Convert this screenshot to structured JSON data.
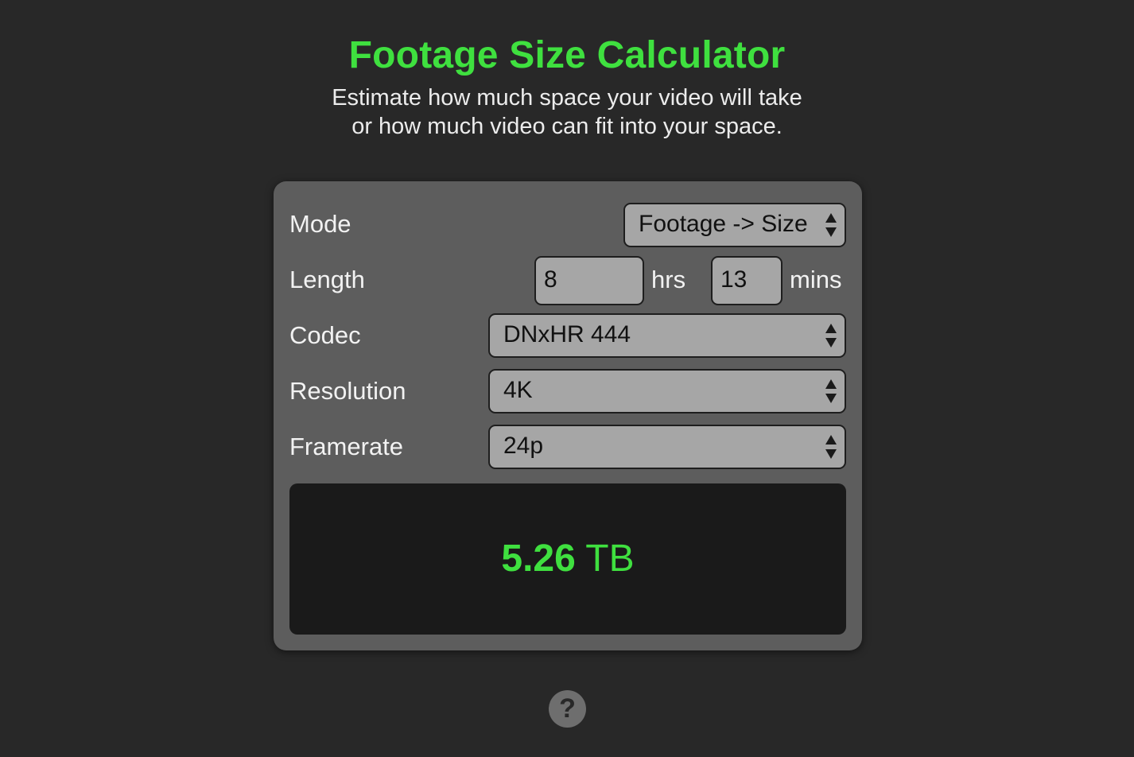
{
  "header": {
    "title": "Footage Size Calculator",
    "subtitle_line1": "Estimate how much space your video will take",
    "subtitle_line2": "or how much video can fit into your space."
  },
  "form": {
    "mode_label": "Mode",
    "mode_value": "Footage -> Size",
    "length_label": "Length",
    "hours_value": "8",
    "hours_unit": "hrs",
    "minutes_value": "13",
    "minutes_unit": "mins",
    "codec_label": "Codec",
    "codec_value": "DNxHR 444",
    "resolution_label": "Resolution",
    "resolution_value": "4K",
    "framerate_label": "Framerate",
    "framerate_value": "24p"
  },
  "result": {
    "number": "5.26",
    "unit": "TB"
  },
  "help": {
    "icon": "question-circle-icon",
    "glyph": "?"
  },
  "colors": {
    "accent": "#3fe03f",
    "background": "#282828",
    "card": "#5d5d5d",
    "field": "#a6a6a6",
    "result_bg": "#1a1a1a"
  }
}
